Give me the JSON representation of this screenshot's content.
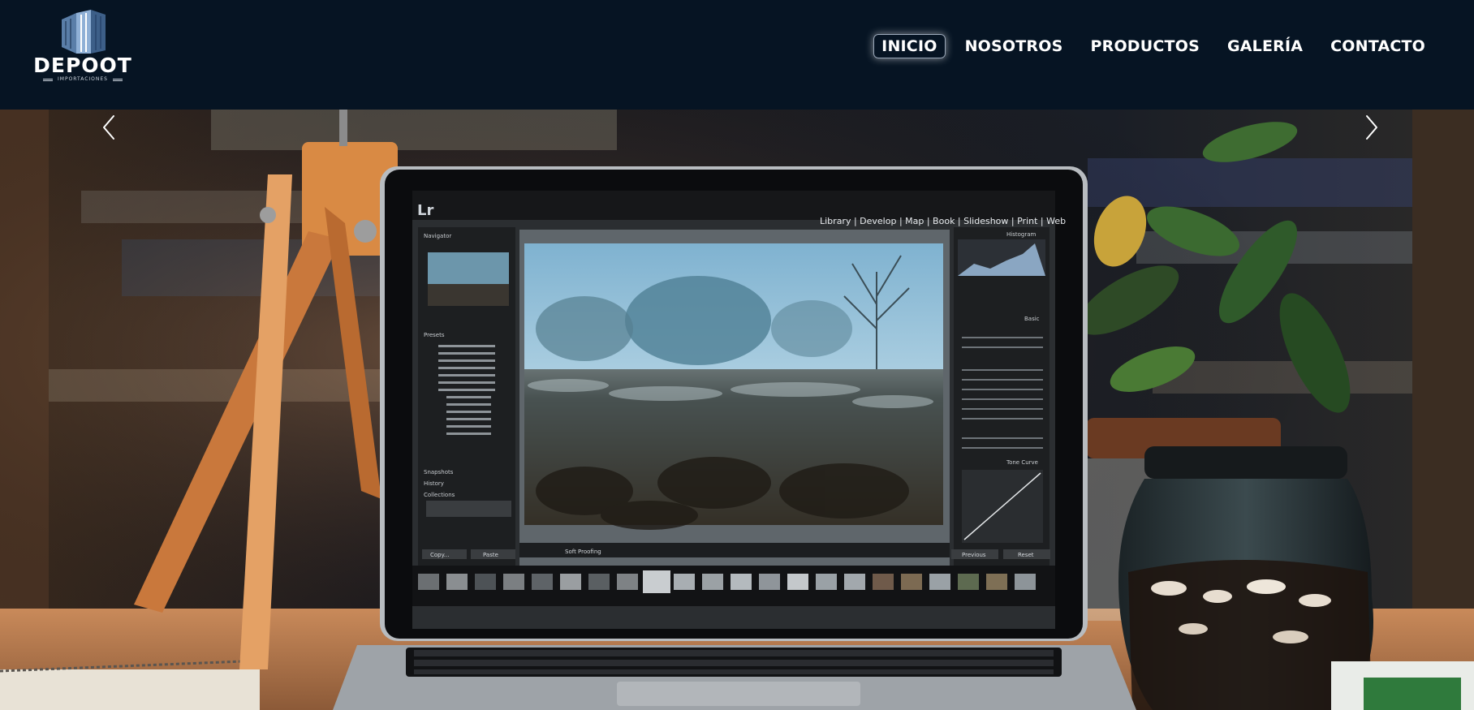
{
  "brand": {
    "name": "DEPOOT",
    "tagline": "IMPORTACIONES",
    "logo_icon": "building-icon"
  },
  "nav": {
    "items": [
      {
        "label": "INICIO",
        "active": true
      },
      {
        "label": "NOSOTROS",
        "active": false
      },
      {
        "label": "PRODUCTOS",
        "active": false
      },
      {
        "label": "GALERÍA",
        "active": false
      },
      {
        "label": "CONTACTO",
        "active": false
      }
    ]
  },
  "slider": {
    "prev_icon": "chevron-left-icon",
    "next_icon": "chevron-right-icon"
  },
  "screen_app": {
    "logo": "Lr",
    "modules": "Library | Develop | Map | Book | Slideshow | Print | Web",
    "left_panels": [
      "Navigator",
      "Presets",
      "Snapshots",
      "History",
      "Collections"
    ],
    "right_panels": [
      "Histogram",
      "Basic",
      "Tone Curve"
    ],
    "buttons": [
      "Copy...",
      "Paste",
      "Soft Proofing",
      "Previous",
      "Reset"
    ]
  },
  "colors": {
    "header_bg": "#061423",
    "nav_text": "#ffffff"
  }
}
